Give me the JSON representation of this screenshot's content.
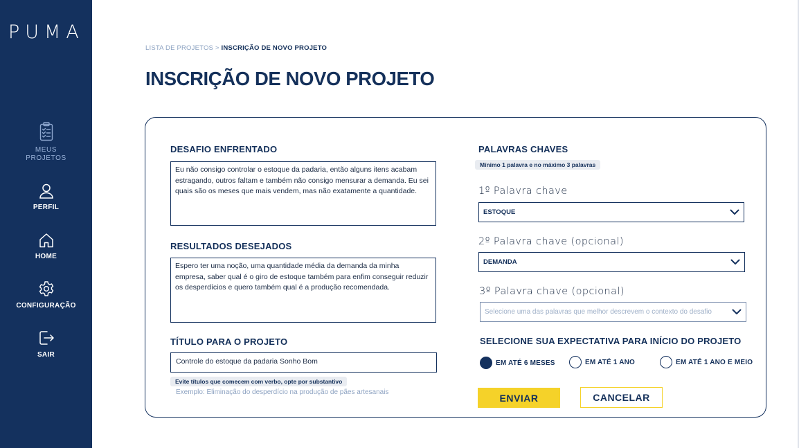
{
  "app": {
    "logo": "PUMA"
  },
  "sidebar": {
    "items": [
      {
        "label": "MEUS\nPROJETOS",
        "icon": "clipboard-list-icon",
        "active": true
      },
      {
        "label": "PERFIL",
        "icon": "user-icon"
      },
      {
        "label": "HOME",
        "icon": "home-icon"
      },
      {
        "label": "CONFIGURAÇÃO",
        "icon": "gear-icon"
      },
      {
        "label": "SAIR",
        "icon": "logout-icon"
      }
    ]
  },
  "breadcrumb": {
    "parent": "LISTA DE PROJETOS",
    "separator": " > ",
    "current": "INSCRIÇÃO DE NOVO PROJETO"
  },
  "page": {
    "title": "INSCRIÇÃO DE NOVO PROJETO"
  },
  "form": {
    "challenge": {
      "label": "DESAFIO ENFRENTADO",
      "value": "Eu não consigo controlar o estoque da padaria, então alguns itens acabam estragando, outros faltam e também não consigo mensurar a demanda. Eu sei quais são os meses que mais vendem, mas não exatamente a quantidade."
    },
    "results": {
      "label": "RESULTADOS DESEJADOS",
      "value": "Espero ter uma noção, uma quantidade média da demanda da minha empresa, saber qual é o giro de estoque também para enfim conseguir reduzir os desperdícios e quero também qual é a produção recomendada."
    },
    "title_field": {
      "label": "TÍTULO PARA O PROJETO",
      "value": "Controle do estoque da padaria Sonho Bom",
      "tip": "Evite títulos que comecem com verbo, opte por substantivo",
      "example": "Exemplo: Eliminação do desperdício na produção de pães artesanais"
    },
    "keywords": {
      "label": "PALAVRAS CHAVES",
      "tip": "Mínimo 1 palavra e no máximo 3 palavras",
      "k1": {
        "label": "1º Palavra chave",
        "value": "ESTOQUE"
      },
      "k2": {
        "label": "2º Palavra chave (opcional)",
        "value": "DEMANDA"
      },
      "k3": {
        "label": "3º Palavra chave (opcional)",
        "placeholder": "Selecione uma das palavras que melhor descrevem o contexto do desafio"
      }
    },
    "expectation": {
      "label": "SELECIONE SUA EXPECTATIVA PARA INÍCIO DO PROJETO",
      "options": [
        {
          "label": "EM ATÉ 6 MESES",
          "selected": true
        },
        {
          "label": "EM ATÉ 1 ANO",
          "selected": false
        },
        {
          "label": "EM ATÉ 1 ANO E MEIO",
          "selected": false
        }
      ]
    },
    "submit_label": "ENVIAR",
    "cancel_label": "CANCELAR"
  },
  "colors": {
    "sidebar": "#14315e",
    "accent": "#f5d229",
    "text": "#14305a",
    "muted": "#8da3c2"
  }
}
